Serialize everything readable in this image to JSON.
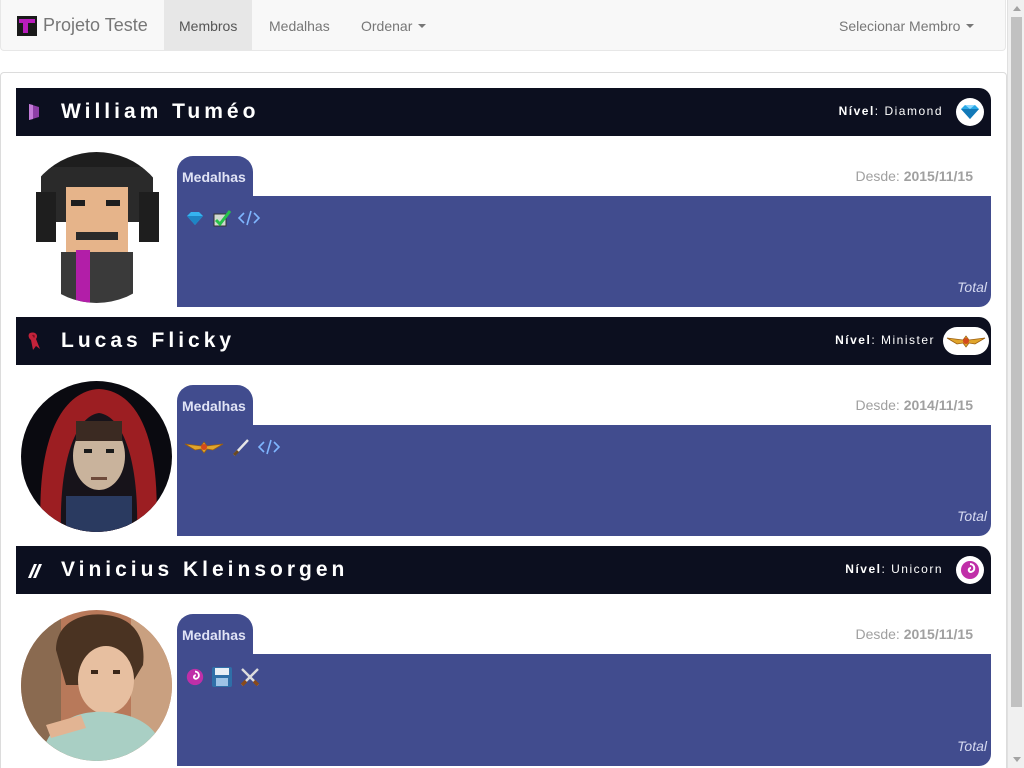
{
  "navbar": {
    "brand": "Projeto Teste",
    "items": [
      {
        "label": "Membros",
        "active": true
      },
      {
        "label": "Medalhas",
        "active": false
      },
      {
        "label": "Ordenar",
        "active": false,
        "dropdown": true
      }
    ],
    "right_dropdown": "Selecionar Membro"
  },
  "colors": {
    "header_bg": "#0c0f1f",
    "medal_panel": "#414c8e",
    "navbar_bg": "#f8f8f8",
    "brand_accent": "#b91dbd"
  },
  "members": [
    {
      "name": "William Tuméo",
      "level_label": "Nível",
      "level": "Diamond",
      "level_icon": "diamond-icon",
      "rank_icon": "purple-shield-icon",
      "medals_title": "Medalhas",
      "since_label": "Desde:",
      "since": "2015/11/15",
      "medals": [
        "diamond-medal-icon",
        "check-medal-icon",
        "code-medal-icon"
      ],
      "total_label": "Total",
      "avatar": "pixel-art-avatar"
    },
    {
      "name": "Lucas Flicky",
      "level_label": "Nível",
      "level": "Minister",
      "level_icon": "gold-wings-icon",
      "rank_icon": "red-ribbon-icon",
      "medals_title": "Medalhas",
      "since_label": "Desde:",
      "since": "2014/11/15",
      "medals": [
        "gold-wings-medal-icon",
        "sword-medal-icon",
        "code-medal-icon"
      ],
      "total_label": "Total",
      "avatar": "hooded-portrait-avatar"
    },
    {
      "name": "Vinicius Kleinsorgen",
      "level_label": "Nível",
      "level": "Unicorn",
      "level_icon": "pink-swirl-icon",
      "rank_icon": "white-stripes-icon",
      "medals_title": "Medalhas",
      "since_label": "Desde:",
      "since": "2015/11/15",
      "medals": [
        "pink-swirl-medal-icon",
        "floppy-disk-medal-icon",
        "crossed-swords-medal-icon"
      ],
      "total_label": "Total",
      "avatar": "photo-portrait-avatar"
    }
  ]
}
